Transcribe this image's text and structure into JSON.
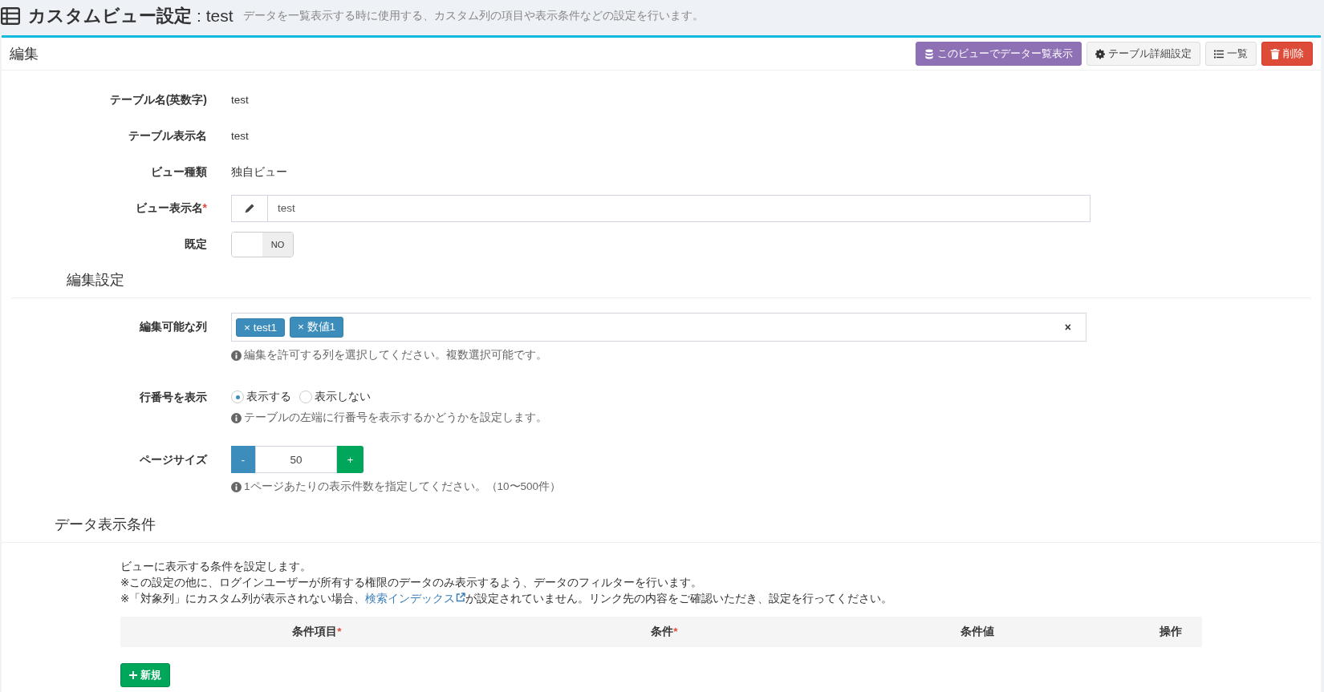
{
  "header": {
    "title": "カスタムビュー設定",
    "name": ": test",
    "description": "データを一覧表示する時に使用する、カスタム列の項目や表示条件などの設定を行います。"
  },
  "panel": {
    "title": "編集",
    "buttons": [
      {
        "label": "このビューでデーター覧表示",
        "kind": "view"
      },
      {
        "label": "テーブル詳細設定",
        "kind": "settings"
      },
      {
        "label": "一覧",
        "kind": "list"
      },
      {
        "label": "削除",
        "kind": "delete"
      }
    ]
  },
  "fields": [
    {
      "kind": "text",
      "label": "テーブル名(英数字)",
      "value": "test"
    },
    {
      "kind": "text",
      "label": "テーブル表示名",
      "value": "test"
    },
    {
      "kind": "text",
      "label": "ビュー種類",
      "value": "独自ビュー"
    },
    {
      "kind": "input",
      "label": "ビュー表示名",
      "required_mark": "*",
      "value": "test"
    },
    {
      "kind": "toggle",
      "label": "既定",
      "on": false,
      "state_label": "NO"
    }
  ],
  "edit_settings": {
    "heading": "編集設定",
    "fields": [
      {
        "kind": "tags",
        "label": "編集可能な列",
        "tags": [
          "× test1",
          "× 数値1"
        ],
        "clear": "×",
        "help": "編集を許可する列を選択してください。複数選択可能です。"
      },
      {
        "kind": "radio",
        "label": "行番号を表示",
        "options": [
          {
            "label": "表示する",
            "selected": true
          },
          {
            "label": "表示しない",
            "selected": false
          }
        ],
        "help": "テーブルの左端に行番号を表示するかどうかを設定します。"
      },
      {
        "kind": "stepper",
        "label": "ページサイズ",
        "minus": "-",
        "value": "50",
        "plus": "+",
        "help": "1ページあたりの表示件数を指定してください。（10〜500件）"
      }
    ]
  },
  "conditions": {
    "heading": "データ表示条件",
    "notes": [
      {
        "text": "ビューに表示する条件を設定します。"
      },
      {
        "text": "※この設定の他に、ログインユーザーが所有する権限のデータのみ表示するよう、データのフィルターを行います。"
      },
      {
        "text": "※「対象列」にカスタム列が表示されない場合、",
        "link": "検索インデックス",
        "after": "が設定されていません。リンク先の内容をご確認いただき、設定を行ってください。"
      }
    ],
    "columns": [
      {
        "label": "条件項目",
        "required_mark": "*"
      },
      {
        "label": "条件",
        "required_mark": "*"
      },
      {
        "label": "条件値"
      },
      {
        "label": "操作"
      }
    ],
    "new_button": "新規"
  }
}
